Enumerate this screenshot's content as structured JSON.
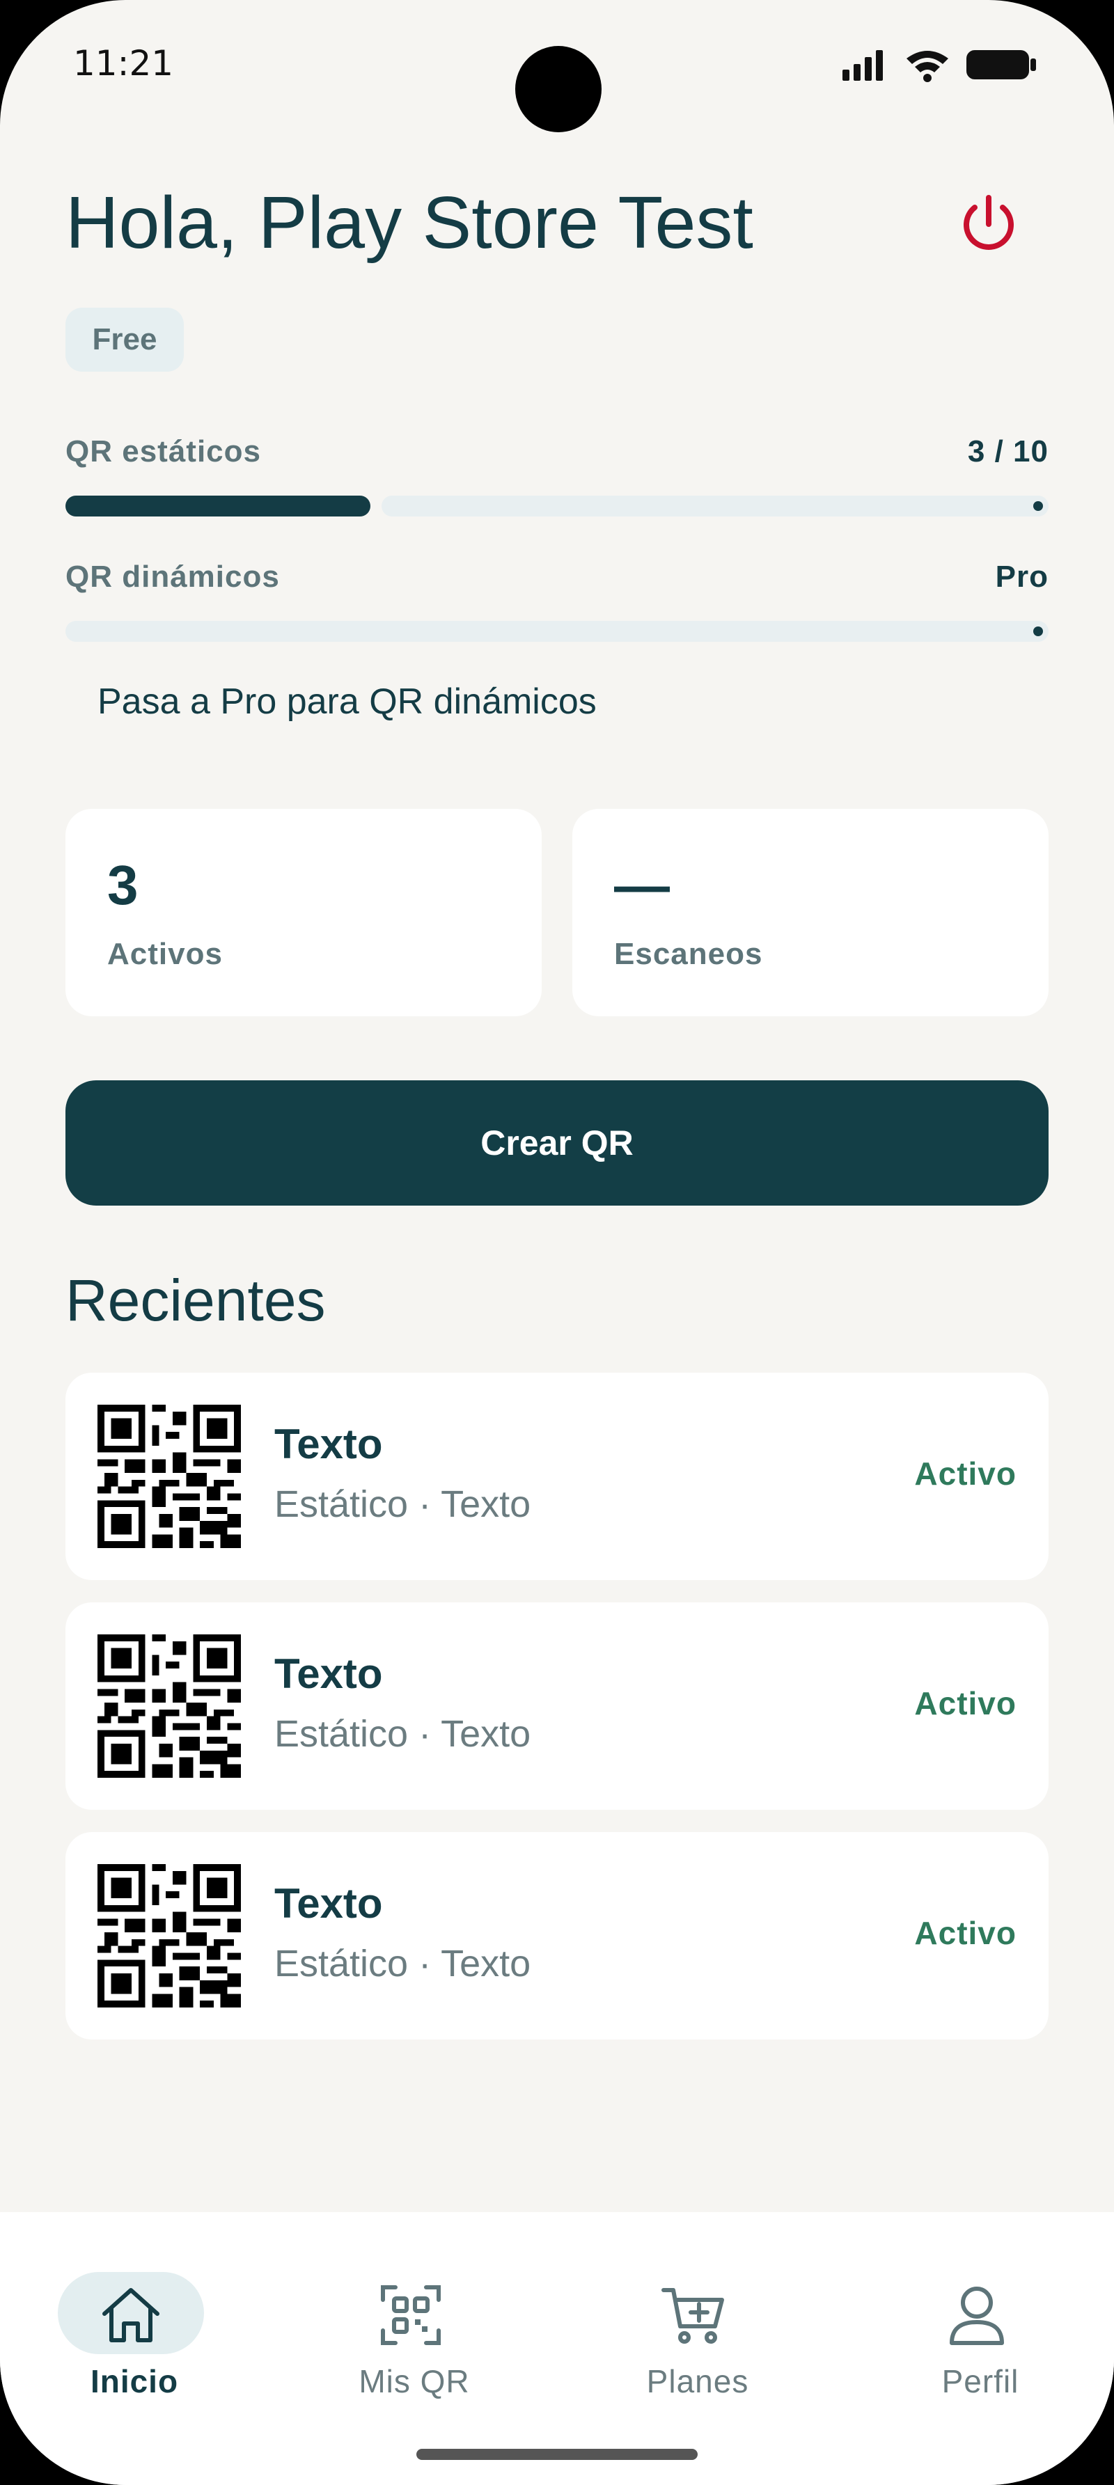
{
  "status_bar": {
    "time": "11:21"
  },
  "header": {
    "greeting": "Hola, Play Store Test",
    "logout_icon": "power-icon"
  },
  "plan": {
    "badge": "Free"
  },
  "usage": {
    "static": {
      "label": "QR estáticos",
      "value": "3 / 10",
      "used": 3,
      "limit": 10
    },
    "dynamic": {
      "label": "QR dinámicos",
      "value": "Pro",
      "used": 0
    },
    "promo": "Pasa a Pro para QR dinámicos"
  },
  "stats": [
    {
      "value": "3",
      "label": "Activos"
    },
    {
      "value": "—",
      "label": "Escaneos"
    }
  ],
  "cta": {
    "label": "Crear QR"
  },
  "recent": {
    "title": "Recientes",
    "items": [
      {
        "title": "Texto",
        "subtitle": "Estático · Texto",
        "status": "Activo"
      },
      {
        "title": "Texto",
        "subtitle": "Estático · Texto",
        "status": "Activo"
      },
      {
        "title": "Texto",
        "subtitle": "Estático · Texto",
        "status": "Activo"
      }
    ]
  },
  "nav": {
    "items": [
      {
        "label": "Inicio",
        "icon": "home-icon",
        "active": true
      },
      {
        "label": "Mis QR",
        "icon": "qr-icon",
        "active": false
      },
      {
        "label": "Planes",
        "icon": "cart-icon",
        "active": false
      },
      {
        "label": "Perfil",
        "icon": "user-icon",
        "active": false
      }
    ]
  },
  "colors": {
    "primary": "#143c45",
    "background": "#f6f5f2",
    "success": "#2f7a5c",
    "danger": "#c8102e"
  }
}
